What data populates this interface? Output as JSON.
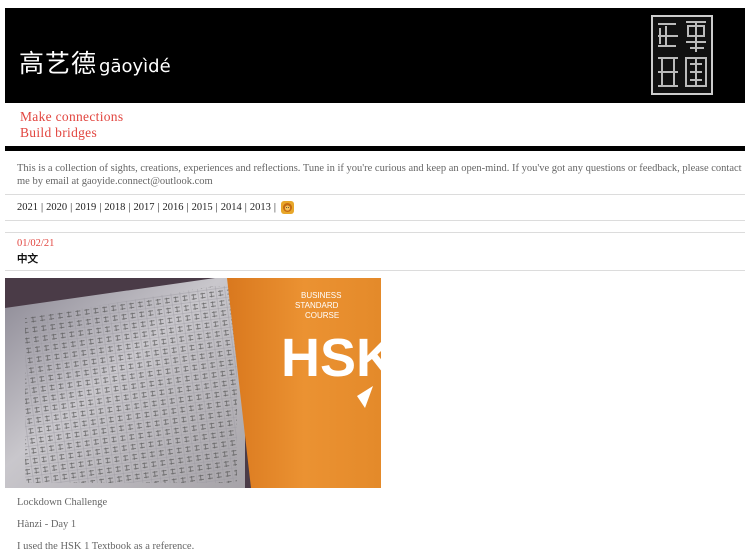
{
  "site": {
    "logo_hanzi": "高艺德",
    "logo_pinyin": "gāoyìdé",
    "seal_alt": "seal"
  },
  "tagline": {
    "line1": "Make connections",
    "line2": "Build bridges"
  },
  "intro": "This is a collection of sights, creations, experiences and reflections. Tune in if you're curious and keep an open-mind. If you've got any questions or feedback, please contact me by email at gaoyide.connect@outlook.com",
  "years": [
    "2021",
    "2020",
    "2019",
    "2018",
    "2017",
    "2016",
    "2015",
    "2014",
    "2013"
  ],
  "post": {
    "date": "01/02/21",
    "title": "中文",
    "image_text": {
      "book_line1": "BUSINESS",
      "book_line2": "STANDARD",
      "book_line3": "COURSE",
      "book_big": "HSK"
    },
    "paragraphs": [
      "Lockdown Challenge",
      "Hànzi - Day 1",
      "I used the HSK 1 Textbook as a reference."
    ]
  },
  "colors": {
    "accent": "#e2453f",
    "header_bg": "#000000",
    "book_orange": "#e48a2a"
  }
}
